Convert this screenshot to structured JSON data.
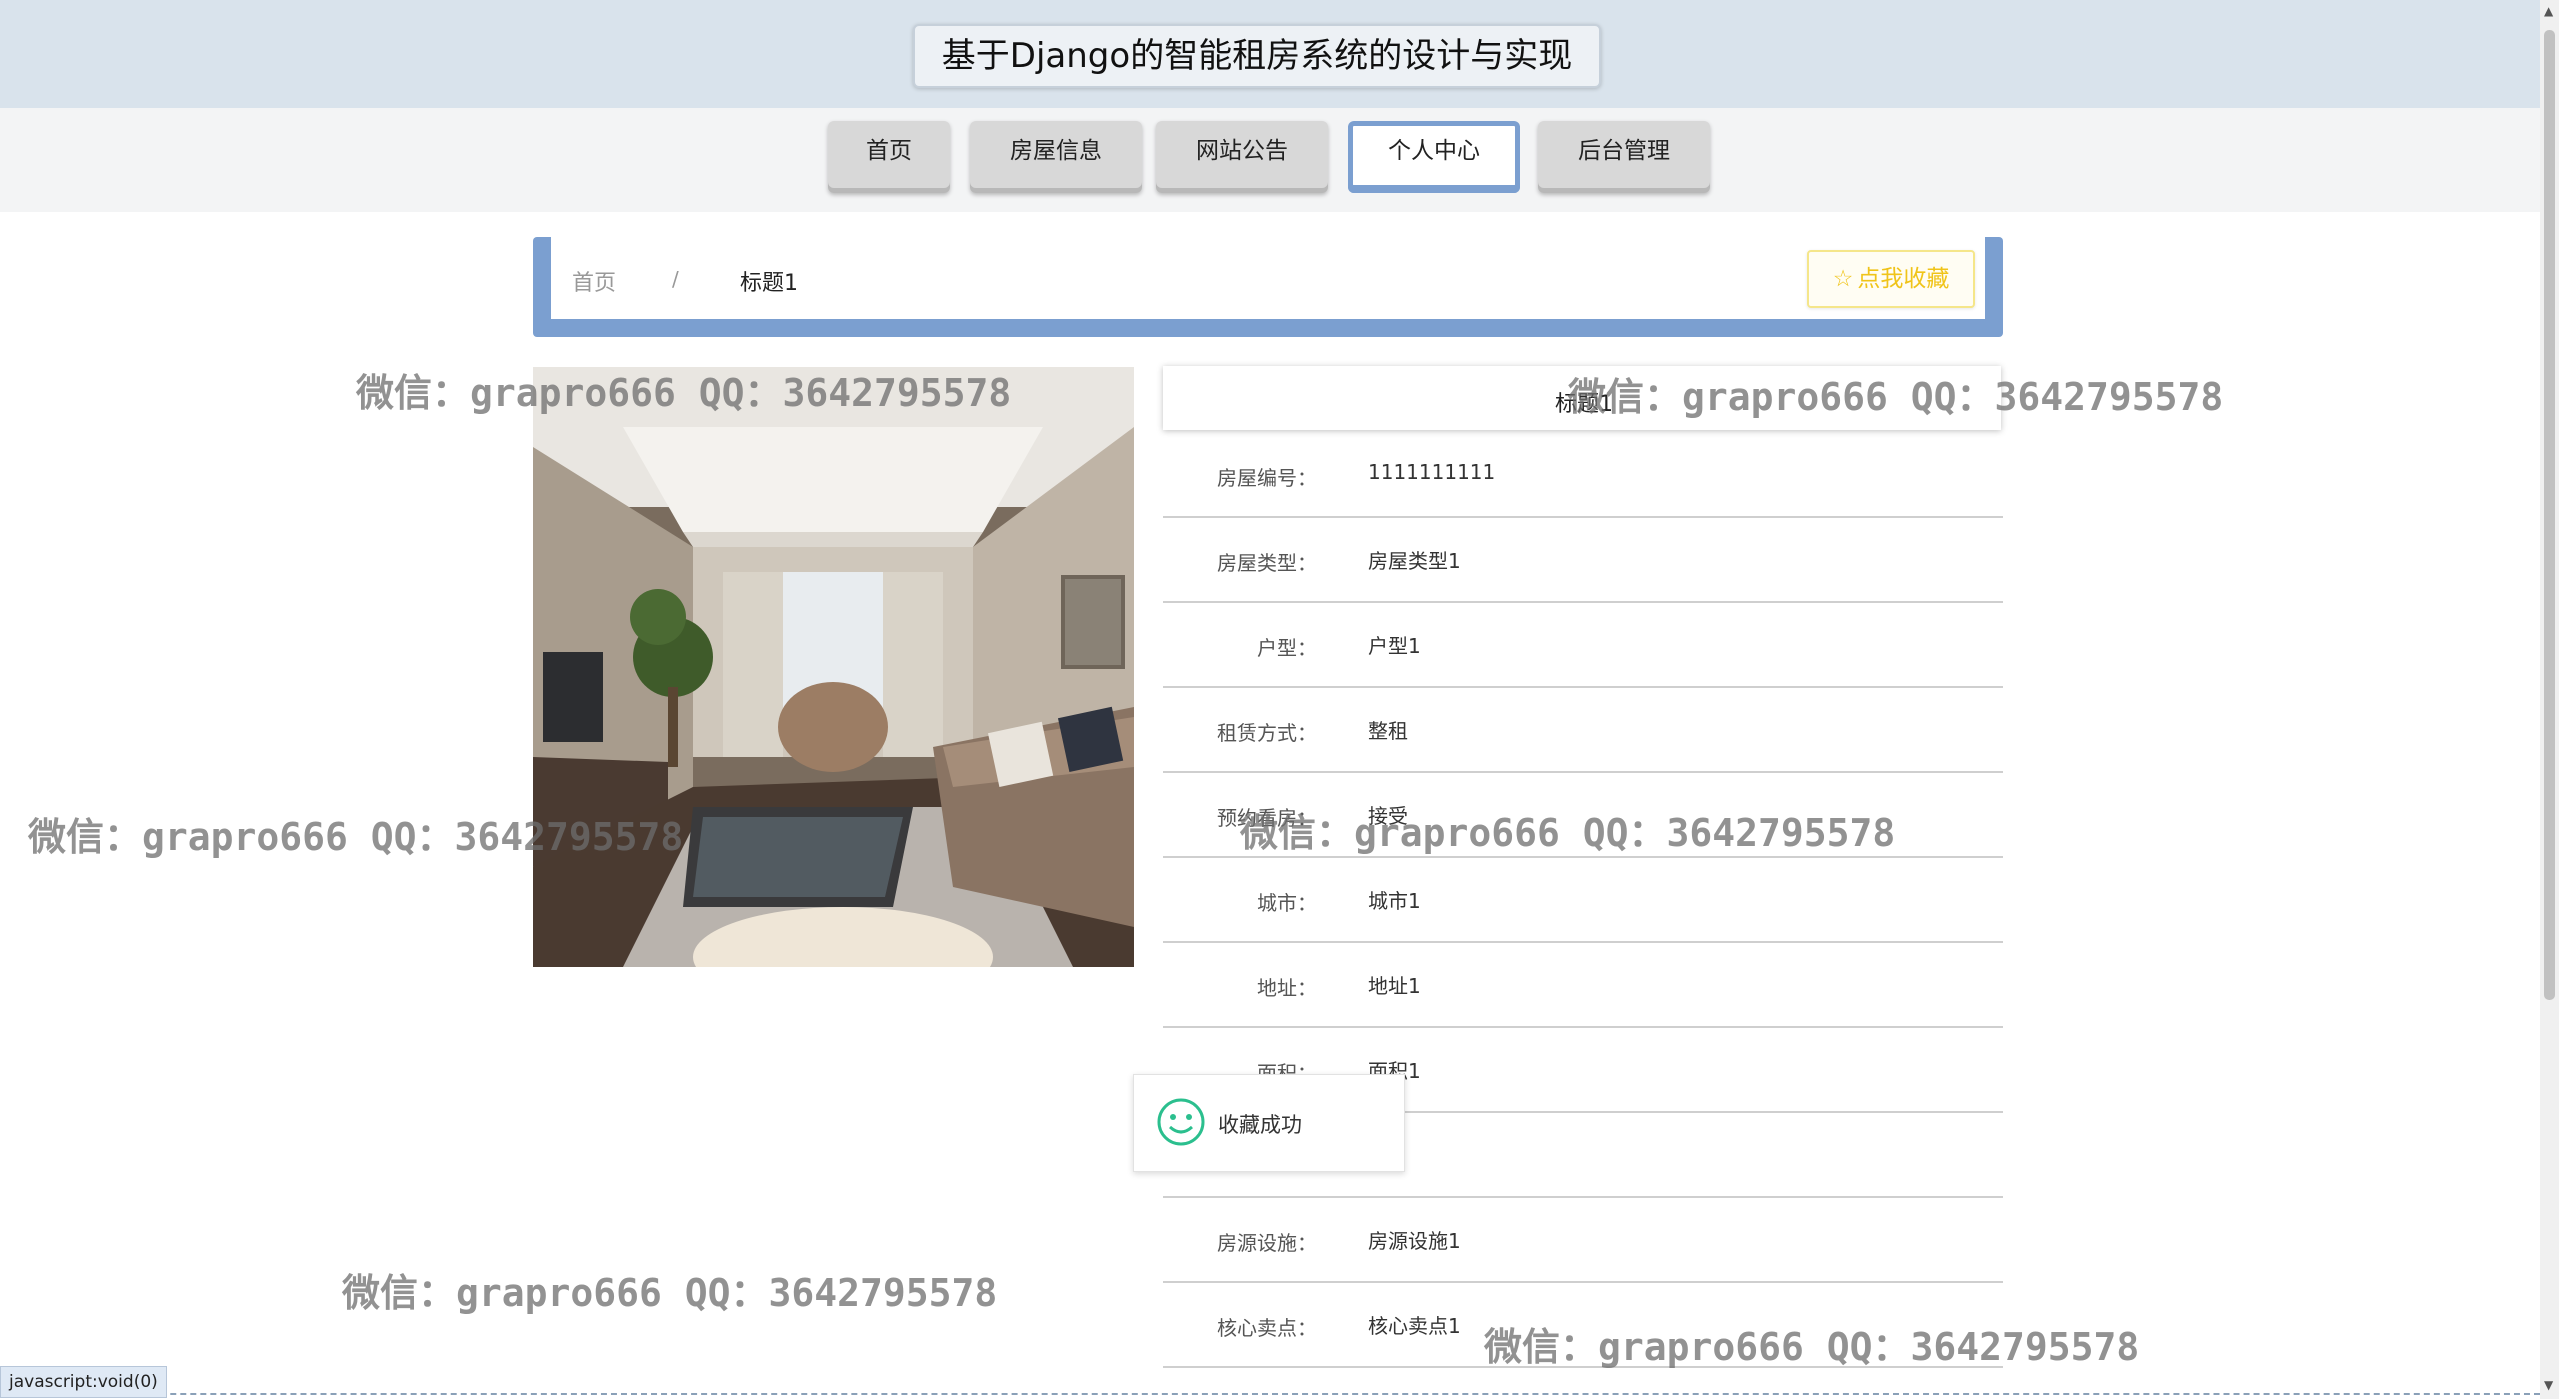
{
  "header": {
    "title": "基于Django的智能租房系统的设计与实现"
  },
  "nav": {
    "items": [
      {
        "label": "首页"
      },
      {
        "label": "房屋信息"
      },
      {
        "label": "网站公告"
      },
      {
        "label": "个人中心"
      },
      {
        "label": "后台管理"
      }
    ],
    "active": "个人中心"
  },
  "breadcrumb": {
    "home": "首页",
    "separator": "/",
    "current": "标题1"
  },
  "collect_button": {
    "label": "点我收藏"
  },
  "detail": {
    "title": "标题1",
    "rows": [
      {
        "label": "房屋编号：",
        "value": "1111111111"
      },
      {
        "label": "房屋类型：",
        "value": "房屋类型1"
      },
      {
        "label": "户型：",
        "value": "户型1"
      },
      {
        "label": "租赁方式：",
        "value": "整租"
      },
      {
        "label": "预约看房：",
        "value": "接受"
      },
      {
        "label": "城市：",
        "value": "城市1"
      },
      {
        "label": "地址：",
        "value": "地址1"
      },
      {
        "label": "面积：",
        "value": "面积1"
      },
      {
        "label": "",
        "value": ""
      },
      {
        "label": "房源设施：",
        "value": "房源设施1"
      },
      {
        "label": "核心卖点：",
        "value": "核心卖点1"
      }
    ]
  },
  "toast": {
    "message": "收藏成功"
  },
  "watermark": {
    "text": "微信：grapro666 QQ：3642795578"
  },
  "status_bar": {
    "url": "javascript:void(0)"
  },
  "colors": {
    "accent": "#7b9fd0",
    "header_bg": "#d9e3ec",
    "collect": "#f0c419",
    "toast_icon": "#2bbf8e"
  }
}
